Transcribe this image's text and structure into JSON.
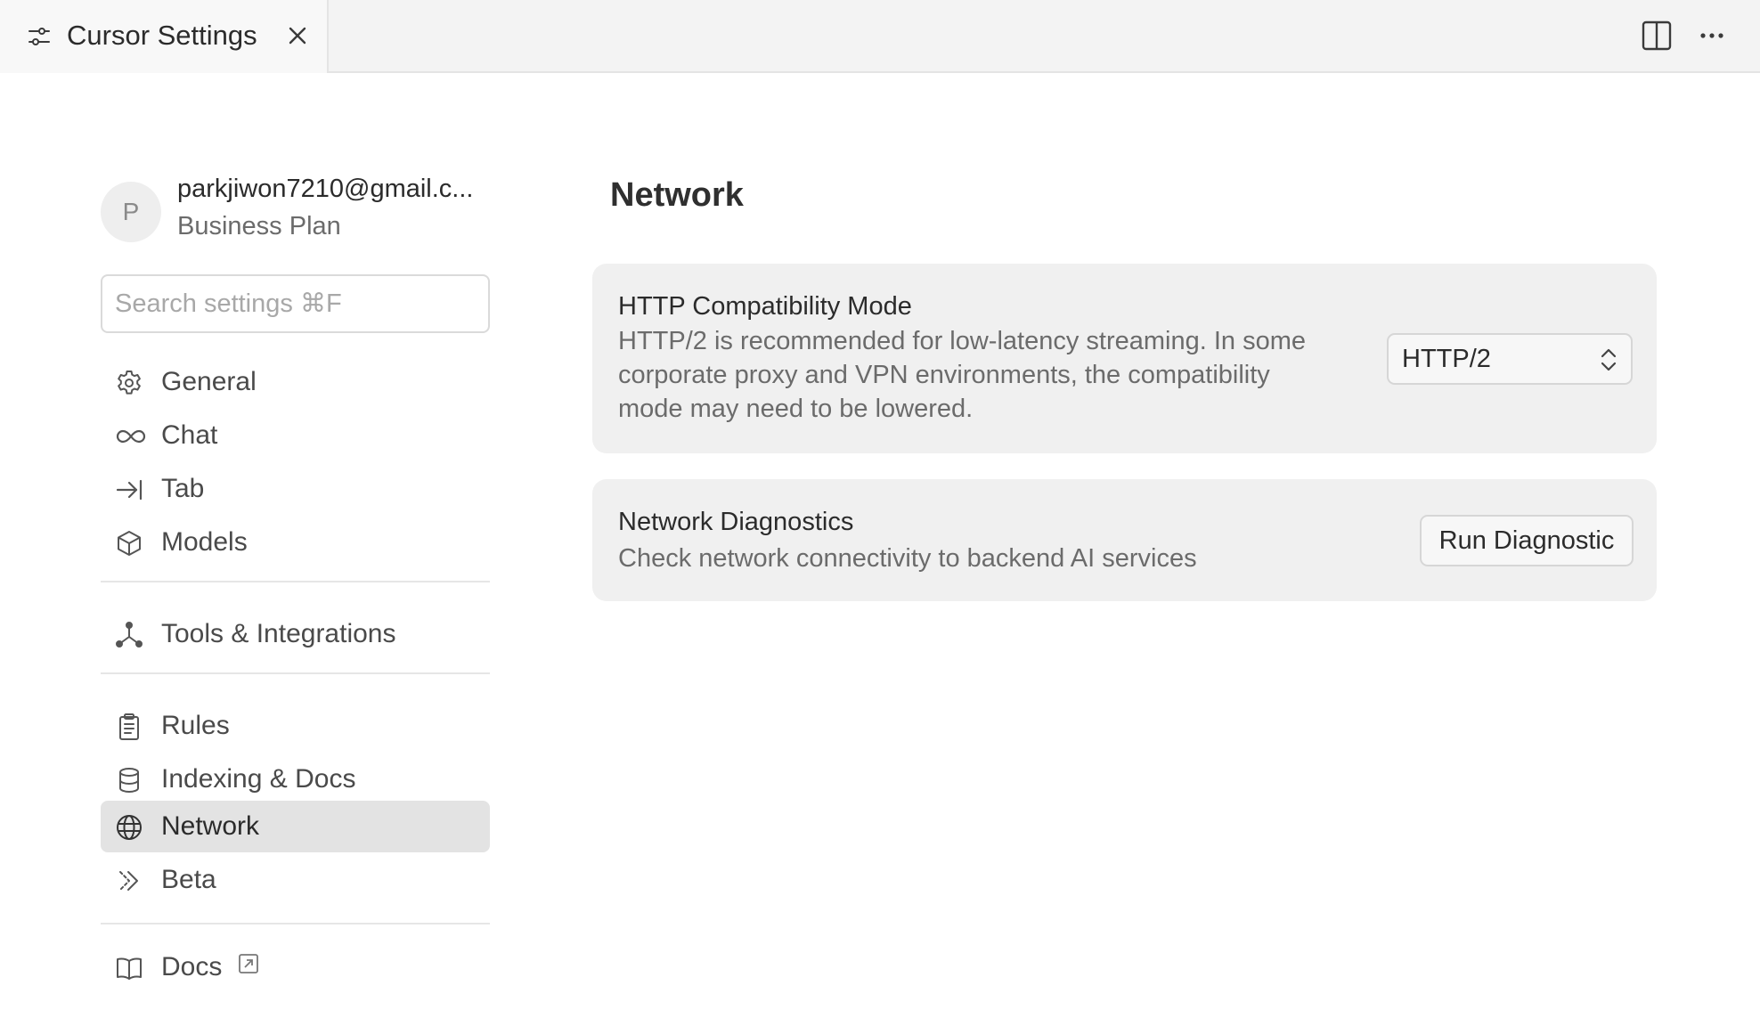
{
  "tabbar": {
    "tab_title": "Cursor Settings",
    "tab_icon": "settings-sliders-icon",
    "close_icon": "close-icon",
    "split_icon": "split-editor-icon",
    "more_icon": "more-ellipsis-icon"
  },
  "account": {
    "avatar_initial": "P",
    "email": "parkjiwon7210@gmail.c...",
    "plan": "Business Plan"
  },
  "search": {
    "placeholder": "Search settings ⌘F",
    "value": ""
  },
  "sidebar": {
    "items": [
      {
        "label": "General",
        "icon": "gear-icon"
      },
      {
        "label": "Chat",
        "icon": "infinity-icon"
      },
      {
        "label": "Tab",
        "icon": "arrow-to-right-icon"
      },
      {
        "label": "Models",
        "icon": "cube-icon"
      },
      {
        "label": "Tools & Integrations",
        "icon": "nodes-icon"
      },
      {
        "label": "Rules",
        "icon": "clipboard-icon"
      },
      {
        "label": "Indexing & Docs",
        "icon": "database-icon"
      },
      {
        "label": "Network",
        "icon": "globe-icon",
        "active": true
      },
      {
        "label": "Beta",
        "icon": "double-chevron-icon"
      },
      {
        "label": "Docs",
        "icon": "book-icon",
        "external": true
      }
    ]
  },
  "main": {
    "title": "Network",
    "http_card": {
      "title": "HTTP Compatibility Mode",
      "desc_line1": "HTTP/2 is recommended for low-latency streaming. In some",
      "desc_line2": "corporate proxy and VPN environments, the compatibility",
      "desc_line3": "mode may need to be lowered.",
      "selected": "HTTP/2"
    },
    "diag_card": {
      "title": "Network Diagnostics",
      "desc": "Check network connectivity to backend AI services",
      "button_label": "Run Diagnostic"
    }
  },
  "colors": {
    "active_item_bg": "#e3e3e3",
    "card_bg": "#f0f0f0",
    "text_primary": "#2b2b2b",
    "text_secondary": "#6b6b6b"
  }
}
